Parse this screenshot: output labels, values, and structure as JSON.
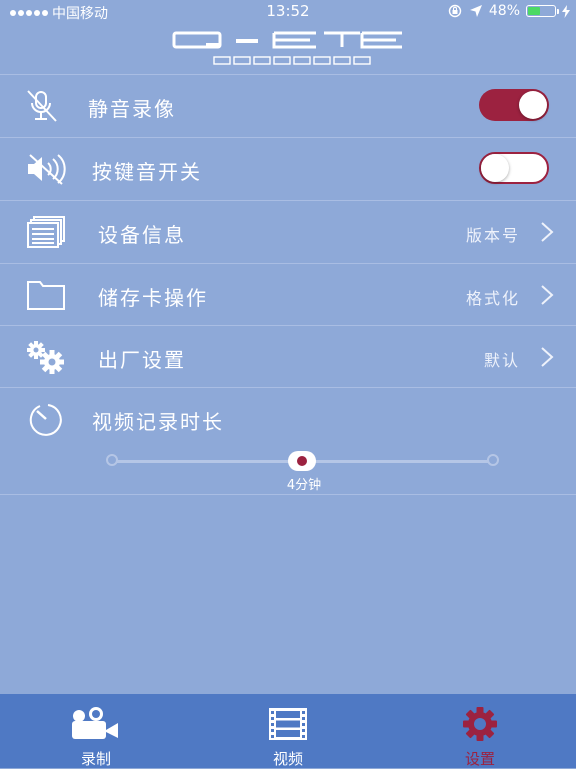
{
  "status_bar": {
    "carrier": "中国移动",
    "time": "13:52",
    "battery_percent": "48%",
    "battery_level": 0.48,
    "battery_color": "#4cd964"
  },
  "header": {
    "logo_main": "Q-EYE",
    "logo_sub": "RECORDER"
  },
  "colors": {
    "background": "#8ea9d8",
    "accent": "#9c2240",
    "tabbar": "#4f79c4"
  },
  "settings": {
    "mute_recording": {
      "label": "静音录像",
      "icon": "mic-muted-icon",
      "enabled": true
    },
    "key_sound": {
      "label": "按键音开关",
      "icon": "speaker-muted-icon",
      "enabled": false
    },
    "device_info": {
      "label": "设备信息",
      "value": "版本号",
      "icon": "document-stack-icon"
    },
    "storage_card": {
      "label": "储存卡操作",
      "value": "格式化",
      "icon": "folder-icon"
    },
    "factory_reset": {
      "label": "出厂设置",
      "value": "默认",
      "icon": "gears-icon"
    },
    "record_duration": {
      "label": "视频记录时长",
      "icon": "timer-icon",
      "value_text": "4分钟",
      "slider_fraction": 0.5
    }
  },
  "tabs": [
    {
      "label": "录制",
      "icon": "video-camera-icon",
      "active": false
    },
    {
      "label": "视频",
      "icon": "film-strip-icon",
      "active": false
    },
    {
      "label": "设置",
      "icon": "gear-icon",
      "active": true
    }
  ]
}
